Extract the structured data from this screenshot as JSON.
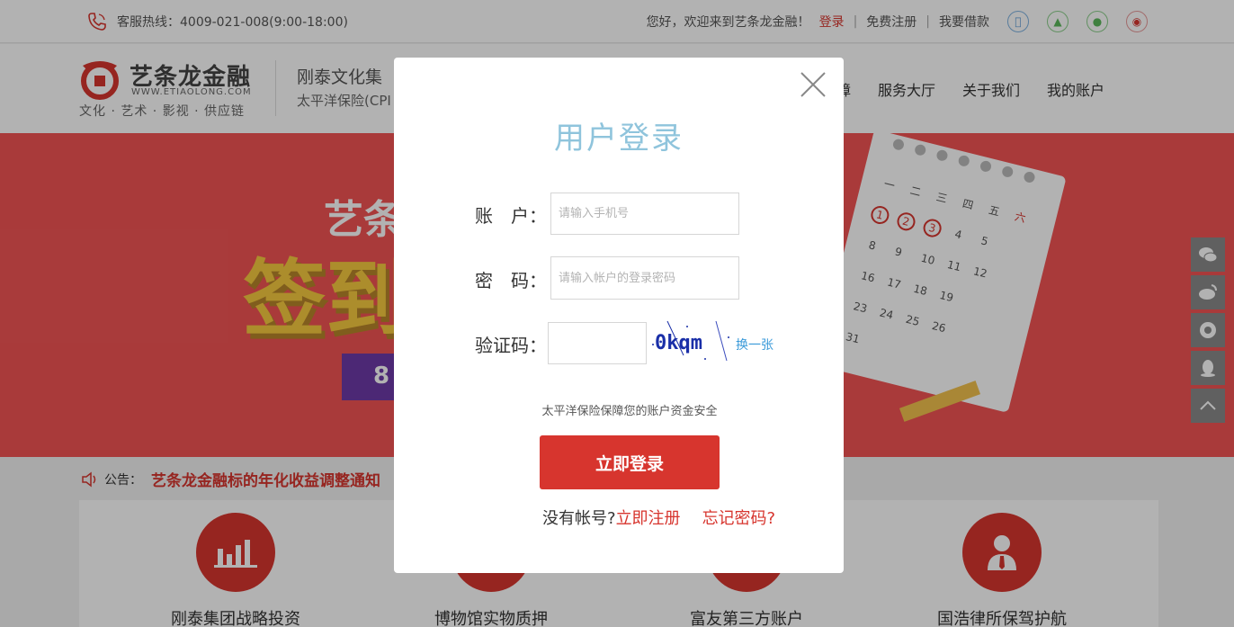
{
  "topbar": {
    "hotline": "客服热线：4009-021-008(9:00-18:00)",
    "welcome": "您好，欢迎来到艺条龙金融！",
    "login": "登录",
    "register": "免费注册",
    "borrow": "我要借款",
    "social_icons": [
      "apple-icon",
      "android-icon",
      "wechat-icon",
      "weibo-icon"
    ]
  },
  "header": {
    "logo_name": "艺条龙金融",
    "logo_url": "WWW.ETIAOLONG.COM",
    "logo_slogan": "文化 · 艺术 · 影视 · 供应链",
    "partner_line1": "刚泰文化集",
    "partner_line2": "太平洋保险(CPI",
    "nav": [
      "障",
      "服务大厅",
      "关于我们",
      "我的账户"
    ]
  },
  "banner": {
    "title_top": "艺条",
    "title_main": "签到",
    "ribbon_text": "8"
  },
  "notice": {
    "label": "公告：",
    "title": "艺条龙金融标的年化收益调整通知"
  },
  "features": [
    {
      "label": "刚泰集团战略投资",
      "icon": "chart-icon"
    },
    {
      "label": "博物馆实物质押",
      "icon": "museum-icon"
    },
    {
      "label": "富友第三方账户",
      "icon": "account-icon"
    },
    {
      "label": "国浩律所保驾护航",
      "icon": "lawyer-icon"
    }
  ],
  "modal": {
    "title": "用户登录",
    "account_label": "账　户：",
    "account_placeholder": "请输入手机号",
    "account_value": "",
    "password_label": "密　码：",
    "password_placeholder": "请输入帐户的登录密码",
    "password_value": "",
    "captcha_label": "验证码：",
    "captcha_value": "",
    "captcha_text": "0kqm",
    "refresh": "换一张",
    "safety": "太平洋保险保障您的账户资金安全",
    "submit": "立即登录",
    "no_account": "没有帐号?",
    "register_now": "立即注册",
    "forgot": "忘记密码?"
  },
  "colors": {
    "accent": "#d7352e",
    "title_blue": "#8fc4dc",
    "link_blue": "#3a9ad9",
    "banner_red": "#f25454"
  }
}
